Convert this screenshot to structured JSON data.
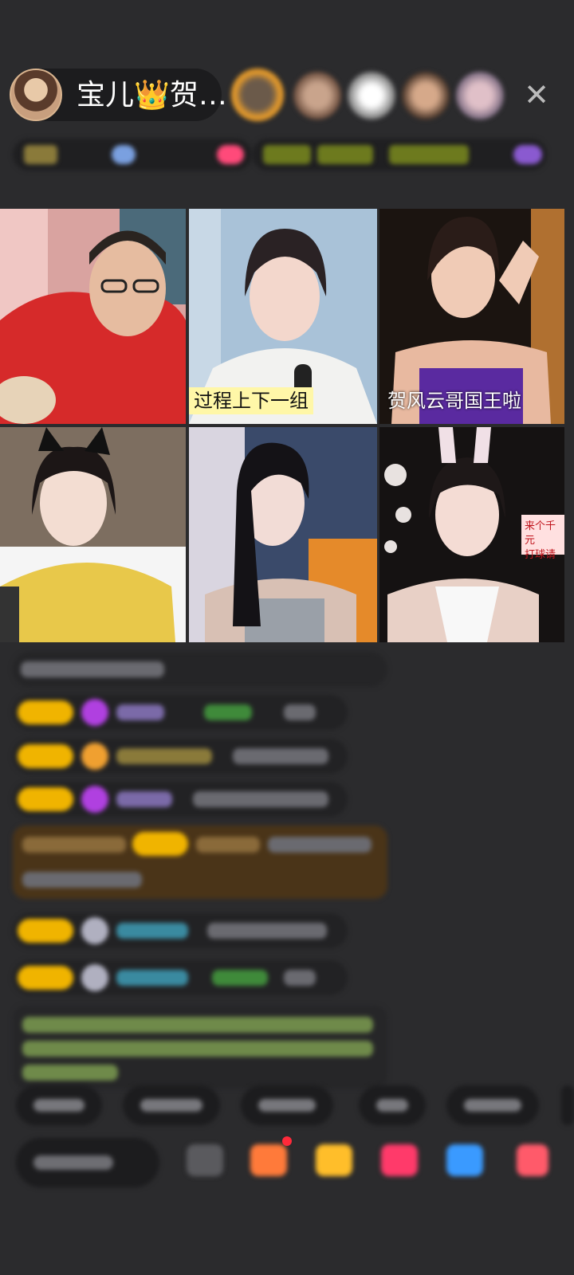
{
  "header": {
    "host_name": "宝儿👑贺…",
    "close_icon": "✕"
  },
  "captions": {
    "tile2": "过程上下一组",
    "tile3": "贺风云哥国王啦",
    "tile6_line1": "来个千元",
    "tile6_line2": "打球请"
  },
  "colors": {
    "background": "#2b2b2d",
    "badge_gold": "#f0b400",
    "caption_bg": "#fff7a8",
    "highlight_chat_bg": "#4a3418"
  }
}
